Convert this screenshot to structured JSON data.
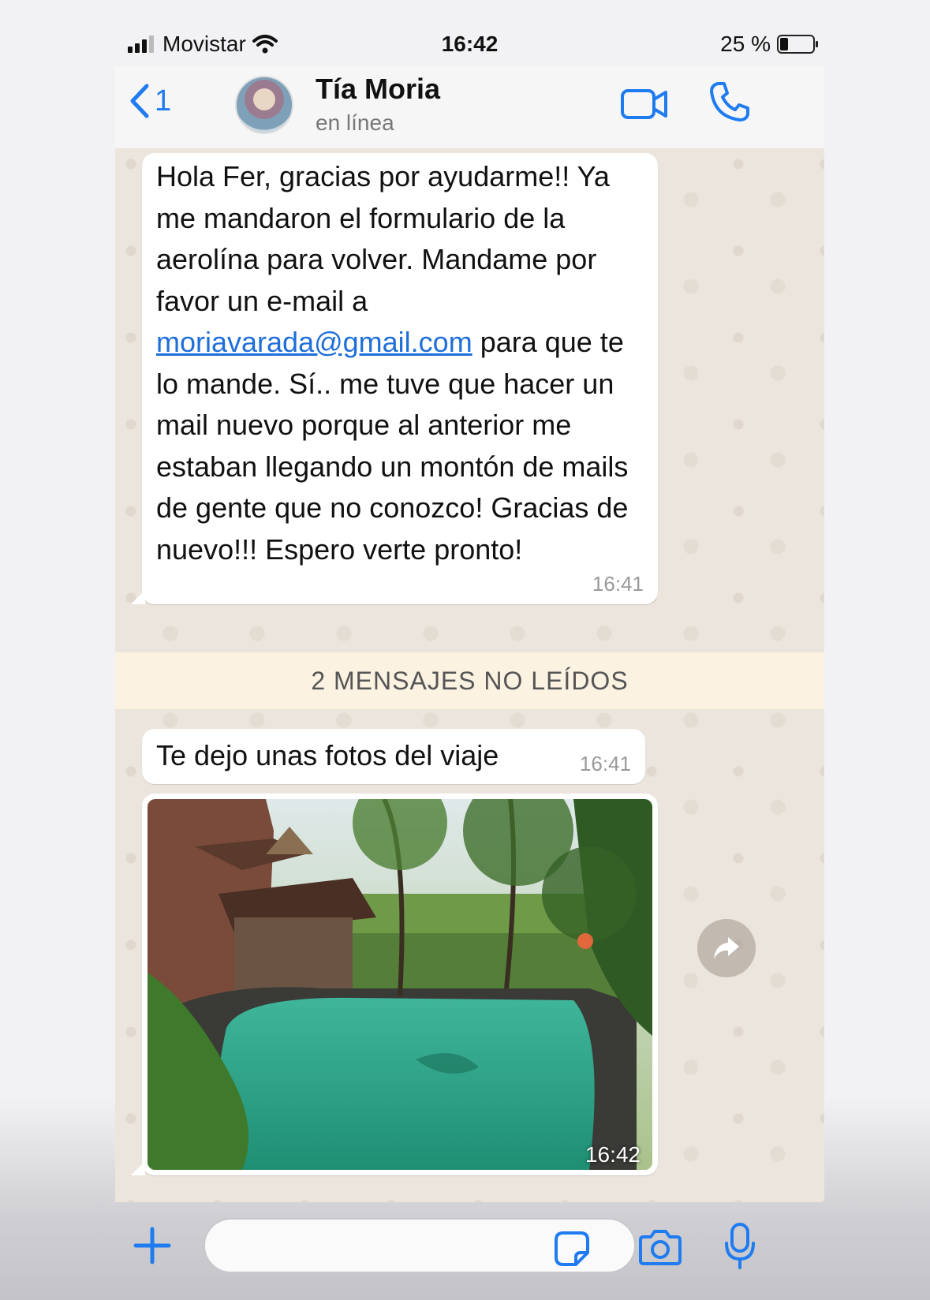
{
  "status_bar": {
    "carrier": "Movistar",
    "time": "16:42",
    "battery_label": "25 %",
    "battery_level": 0.25
  },
  "header": {
    "back_count": "1",
    "contact_name": "Tía Moria",
    "contact_status": "en línea"
  },
  "messages": [
    {
      "text_before_link": "Hola Fer, gracias por ayudarme!! Ya me mandaron el formulario de la aerolína para volver. Mandame por favor un e-mail a ",
      "link": "moriavarada@gmail.com",
      "text_after_link": " para que te lo mande. Sí.. me tuve que hacer un mail nuevo porque al anterior me estaban llegando un montón de mails de gente que no conozco! Gracias de nuevo!!! Espero verte pronto!",
      "time": "16:41"
    },
    {
      "text": "Te dejo unas fotos del viaje",
      "time": "16:41"
    },
    {
      "type": "photo",
      "time": "16:42"
    }
  ],
  "unread_banner": "2 MENSAJES NO LEÍDOS",
  "input": {
    "placeholder": ""
  },
  "colors": {
    "accent": "#1f7cf0",
    "chat_background": "#ece5dd",
    "unread_banner": "#fbf2e2"
  },
  "icons": [
    "back-chevron-icon",
    "video-call-icon",
    "phone-call-icon",
    "forward-icon",
    "plus-icon",
    "sticker-icon",
    "camera-icon",
    "microphone-icon",
    "signal-icon",
    "wifi-icon",
    "battery-icon"
  ]
}
